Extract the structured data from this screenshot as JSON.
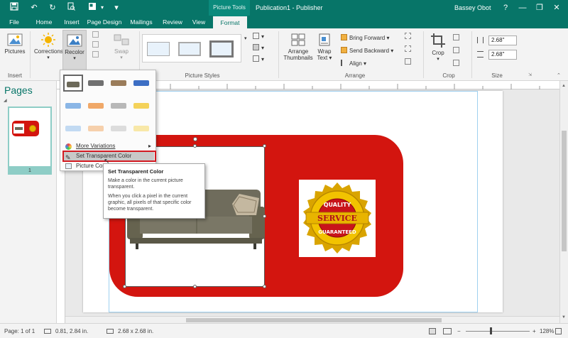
{
  "window": {
    "context_tab": "Picture Tools",
    "document_title": "Publication1  -  Publisher",
    "user_name": "Bassey Obot"
  },
  "tabs": [
    {
      "label": "File"
    },
    {
      "label": "Home"
    },
    {
      "label": "Insert"
    },
    {
      "label": "Page Design"
    },
    {
      "label": "Mailings"
    },
    {
      "label": "Review"
    },
    {
      "label": "View"
    },
    {
      "label": "Format"
    }
  ],
  "ribbon": {
    "pictures": "Pictures",
    "corrections": "Corrections",
    "recolor": "Recolor",
    "swap": "Swap",
    "arrange_thumbnails_1": "Arrange",
    "arrange_thumbnails_2": "Thumbnails",
    "wrap_text_1": "Wrap",
    "wrap_text_2": "Text",
    "bring_forward": "Bring Forward",
    "send_backward": "Send Backward",
    "align": "Align",
    "crop": "Crop",
    "height_value": "2.68\"",
    "width_value": "2.68\"",
    "group_labels": {
      "insert": "Insert",
      "adjust": "A",
      "picture_styles": "Picture Styles",
      "arrange": "Arrange",
      "crop": "Crop",
      "size": "Size"
    }
  },
  "pages_pane": {
    "title": "Pages",
    "page_number": "1"
  },
  "recolor_menu": {
    "more_variations": "More Variations",
    "set_transparent_color": "Set Transparent Color",
    "picture_color_options": "Picture Color"
  },
  "tooltip": {
    "title": "Set Transparent Color",
    "line1": "Make a color in the current picture transparent.",
    "line2": "When you click a pixel in the current graphic, all pixels of that specific color become transparent."
  },
  "seal": {
    "top_text": "QUALITY",
    "middle_text": "SERVICE",
    "bottom_text": "GUARANTEED"
  },
  "statusbar": {
    "page": "Page: 1 of 1",
    "position": "0.81, 2.84 in.",
    "size": "2.68 x 2.68 in.",
    "zoom": "128%"
  },
  "colors": {
    "accent": "#077568",
    "panel_red": "#d3150f",
    "highlight_red": "#d31a22"
  }
}
